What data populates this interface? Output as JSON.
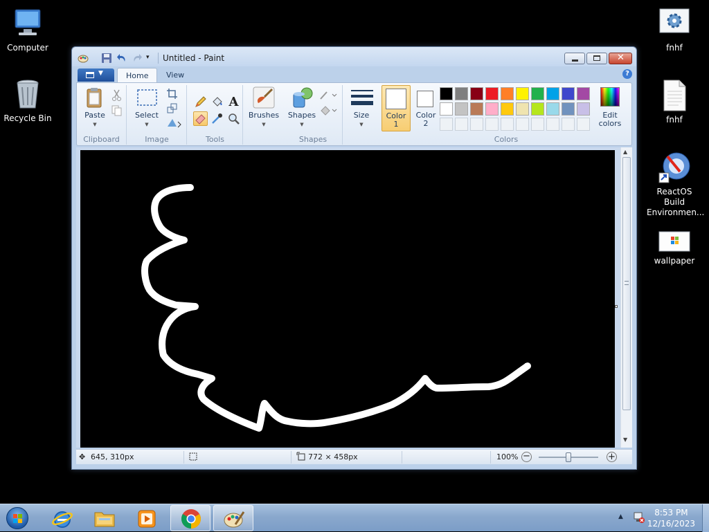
{
  "desktop": {
    "icons": [
      {
        "label": "Computer",
        "icon": "computer-icon"
      },
      {
        "label": "Recycle Bin",
        "icon": "recycle-bin-icon"
      },
      {
        "label": "fnhf",
        "icon": "settings-app-icon"
      },
      {
        "label": "fnhf",
        "icon": "text-file-icon"
      },
      {
        "label": "ReactOS Build Environmen...",
        "icon": "reactos-shortcut-icon"
      },
      {
        "label": "wallpaper",
        "icon": "image-file-icon"
      }
    ]
  },
  "window": {
    "title": "Untitled - Paint",
    "tabs": {
      "home": "Home",
      "view": "View"
    },
    "groups": {
      "clipboard": {
        "label": "Clipboard",
        "paste": "Paste"
      },
      "image": {
        "label": "Image",
        "select": "Select"
      },
      "tools": {
        "label": "Tools"
      },
      "brushes": {
        "label": "Brushes"
      },
      "shapes": {
        "label": "Shapes",
        "shapes_btn": "Shapes"
      },
      "size": {
        "label": "Size"
      },
      "colors": {
        "label": "Colors",
        "color1": "Color\n1",
        "color1_l1": "Color",
        "color1_l2": "1",
        "color2_l1": "Color",
        "color2_l2": "2",
        "edit_l1": "Edit",
        "edit_l2": "colors",
        "color1_value": "#ffffff",
        "color2_value": "#ffffff",
        "palette_row1": [
          "#000000",
          "#7f7f7f",
          "#880015",
          "#ed1c24",
          "#ff7f27",
          "#fff200",
          "#22b14c",
          "#00a2e8",
          "#3f48cc",
          "#a349a4"
        ],
        "palette_row2": [
          "#ffffff",
          "#c3c3c3",
          "#b97a57",
          "#ffaec9",
          "#ffc90e",
          "#efe4b0",
          "#b5e61d",
          "#99d9ea",
          "#7092be",
          "#c8bfe7"
        ]
      }
    },
    "status": {
      "cursor_pos": "645, 310px",
      "canvas_size": "772 × 458px",
      "zoom": "100%",
      "zoom_level_percent": 100
    },
    "canvas": {
      "background": "#000000",
      "stroke_color": "#ffffff"
    }
  },
  "taskbar": {
    "time": "8:53 PM",
    "date": "12/16/2023"
  }
}
